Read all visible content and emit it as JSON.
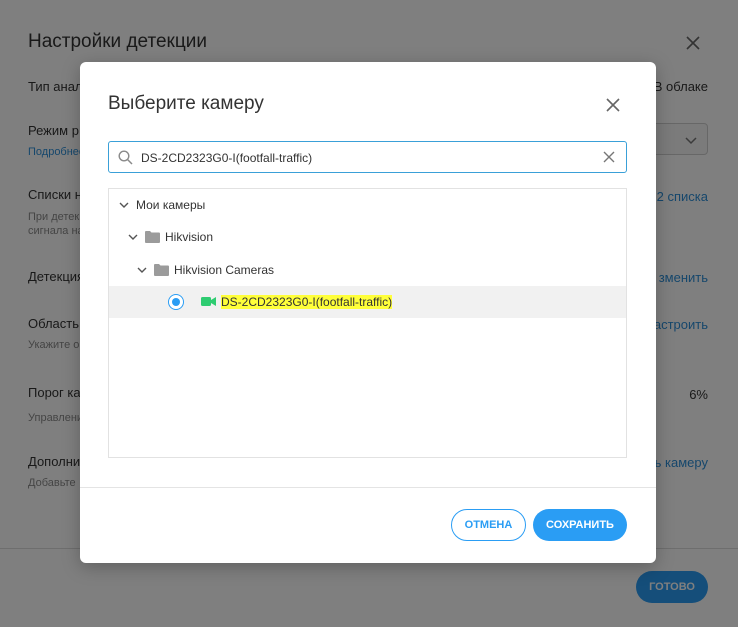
{
  "background": {
    "title": "Настройки детекции",
    "rows": [
      {
        "label": "Тип анал",
        "sub": "",
        "right": "В облаке"
      },
      {
        "label": "Режим р",
        "sub": "Подробнее",
        "right": ""
      },
      {
        "label": "Списки н",
        "sub": "При детек\nсигнала на",
        "right": "2 списка"
      },
      {
        "label": "Детекция",
        "sub": "",
        "right": "зменить"
      },
      {
        "label": "Область",
        "sub": "Укажите о",
        "right": "астроить"
      },
      {
        "label": "Порог ка",
        "sub": "Управлени",
        "right": "6%"
      },
      {
        "label": "Дополни",
        "sub": "Добавьте",
        "right": "ь камеру"
      }
    ],
    "done_label": "ГОТОВО"
  },
  "modal": {
    "title": "Выберите камеру",
    "search": {
      "value": "DS-2CD2323G0-I(footfall-traffic)",
      "placeholder": ""
    },
    "tree": {
      "root": "Мои камеры",
      "group": "Hikvision",
      "subgroup": "Hikvision Cameras",
      "camera": "DS-2CD2323G0-I(footfall-traffic)",
      "camera_selected": true
    },
    "cancel_label": "ОТМЕНА",
    "save_label": "СОХРАНИТЬ"
  },
  "colors": {
    "accent": "#2a9df4",
    "camera_icon": "#2ecc71",
    "highlight": "#ffff3a"
  }
}
